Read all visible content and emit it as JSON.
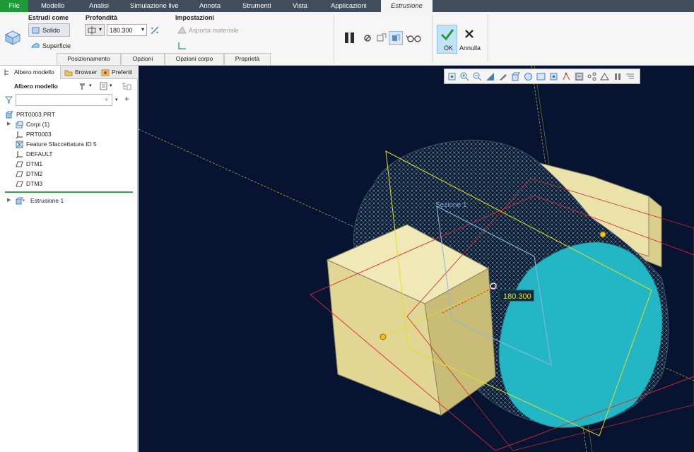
{
  "menu": {
    "items": [
      "File",
      "Modello",
      "Analisi",
      "Simulazione live",
      "Annota",
      "Strumenti",
      "Vista",
      "Applicazioni"
    ],
    "active_tab": "Estrusione"
  },
  "ribbon": {
    "estrudi_come": {
      "title": "Estrudi come",
      "solido": "Solido",
      "superficie": "Superficie"
    },
    "profondita": {
      "title": "Profondità",
      "value": "180.300"
    },
    "impostazioni": {
      "title": "Impostazioni",
      "asporta": "Asporta materiale"
    },
    "ok_label": "OK",
    "annulla_label": "Annulla",
    "subtabs": [
      "Posizionamento",
      "Opzioni",
      "Opzioni corpo",
      "Proprietà"
    ]
  },
  "panel": {
    "tabs": [
      "Albero modello",
      "Browser",
      "Preferiti"
    ],
    "header": "Albero modello",
    "filter_placeholder": "",
    "tree": [
      {
        "label": "PRT0003.PRT",
        "icon": "part-icon"
      },
      {
        "label": "Corpi (1)",
        "icon": "bodies-icon"
      },
      {
        "label": "PRT0003",
        "icon": "csys-icon"
      },
      {
        "label": "Feature Sfaccettatura ID 5",
        "icon": "facet-icon"
      },
      {
        "label": "DEFAULT",
        "icon": "csys-icon"
      },
      {
        "label": "DTM1",
        "icon": "plane-icon"
      },
      {
        "label": "DTM2",
        "icon": "plane-icon"
      },
      {
        "label": "DTM3",
        "icon": "plane-icon"
      }
    ],
    "feature": {
      "label": "Estrusione 1",
      "icon": "extrude-icon"
    }
  },
  "viewport": {
    "section_label": "Sezione 1",
    "dimension_value": "180.300",
    "background": "#061431"
  },
  "colors": {
    "menubar": "#3f4d5c",
    "file_tab": "#1f9a39",
    "solid_face": "#eae2a8",
    "section_fill": "#23b6c4",
    "plane_red": "#e0262c",
    "plane_yellow": "#e3e01e"
  }
}
